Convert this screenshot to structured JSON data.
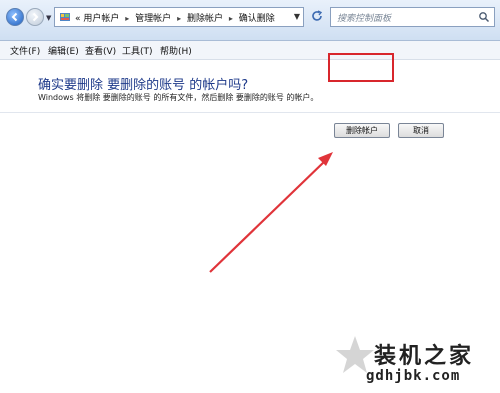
{
  "breadcrumb": {
    "prefix": "«",
    "items": [
      "用户帐户",
      "管理帐户",
      "删除帐户",
      "确认删除"
    ]
  },
  "search": {
    "placeholder": "搜索控制面板"
  },
  "menu": {
    "file": "文件(F)",
    "edit": "编辑(E)",
    "view": "查看(V)",
    "tools": "工具(T)",
    "help": "帮助(H)"
  },
  "dialog": {
    "heading": "确实要删除 要删除的账号 的帐户吗?",
    "description": "Windows 将删除 要删除的账号 的所有文件，然后删除 要删除的账号 的帐户。",
    "delete_label": "删除帐户",
    "cancel_label": "取消"
  },
  "watermark": {
    "title": "装机之家",
    "url": "gdhjbk.com"
  },
  "colors": {
    "highlight": "#d8262c",
    "heading": "#1e3a8a"
  },
  "icons": [
    "back-icon",
    "forward-icon",
    "control-panel-icon",
    "refresh-icon",
    "search-icon",
    "star-icon"
  ]
}
